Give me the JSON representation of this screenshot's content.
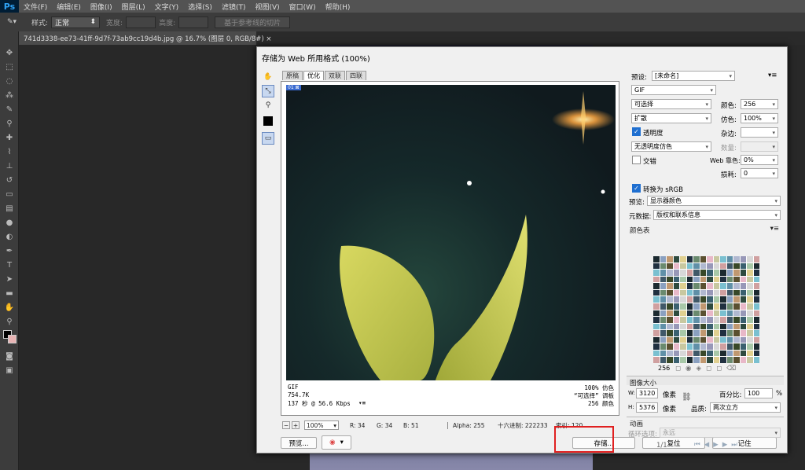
{
  "app": {
    "logo": "Ps",
    "menu": [
      "文件(F)",
      "编辑(E)",
      "图像(I)",
      "图层(L)",
      "文字(Y)",
      "选择(S)",
      "滤镜(T)",
      "视图(V)",
      "窗口(W)",
      "帮助(H)"
    ]
  },
  "options": {
    "style_label": "样式:",
    "style_value": "正常",
    "width_label": "宽度:",
    "height_label": "高度:",
    "guides_button": "基于参考线的切片"
  },
  "document_tab": "741d3338-ee73-41ff-9d7f-73ab9cc19d4b.jpg @ 16.7% (图层 0, RGB/8#)",
  "dialog": {
    "title": "存储为 Web 所用格式 (100%)",
    "view_tabs": [
      "原稿",
      "优化",
      "双联",
      "四联"
    ],
    "active_view_tab": "优化",
    "image_info": {
      "format": "GIF",
      "size": "754.7K",
      "time": "137 秒 @ 56.6 Kbps",
      "dither_pct": "100% 仿色",
      "palette_name": "“可选择” 调板",
      "colors_count": "256 颜色"
    },
    "status": {
      "zoom": "100%",
      "r": "R: 34",
      "g": "G: 34",
      "b": "B: 51",
      "alpha": "Alpha: 255",
      "hex": "十六进制: 222233",
      "index": "索引: 120"
    },
    "buttons": {
      "preview": "预览...",
      "save": "存储...",
      "reset": "复位",
      "remember": "记住"
    },
    "settings": {
      "preset_label": "预设:",
      "preset_value": "[未命名]",
      "format": "GIF",
      "reduction": "可选择",
      "colors_label": "颜色:",
      "colors_value": "256",
      "dither_algo": "扩散",
      "dither_label": "仿色:",
      "dither_value": "100%",
      "transparency_label": "透明度",
      "matte_label": "杂边:",
      "transparency_dither": "无透明度仿色",
      "amount_label": "数量:",
      "interlaced_label": "交错",
      "web_snap_label": "Web 靠色:",
      "web_snap_value": "0%",
      "lossy_label": "损耗:",
      "lossy_value": "0",
      "srgb_label": "转换为 sRGB",
      "preview_label": "预览:",
      "preview_value": "显示器颜色",
      "metadata_label": "元数据:",
      "metadata_value": "版权和联系信息"
    },
    "color_table": {
      "title": "颜色表",
      "count": "256"
    },
    "image_size": {
      "title": "图像大小",
      "w_label": "W:",
      "w_value": "3120",
      "h_label": "H:",
      "h_value": "5376",
      "unit": "像素",
      "percent_label": "百分比:",
      "percent_value": "100",
      "percent_unit": "%",
      "quality_label": "品质:",
      "quality_value": "两次立方"
    },
    "animation": {
      "title": "动画",
      "loop_label": "循环选项:",
      "loop_value": "永远",
      "frame": "1/1"
    }
  },
  "colors": {
    "highlight": "#e02020",
    "accent": "#1f6fd0"
  }
}
